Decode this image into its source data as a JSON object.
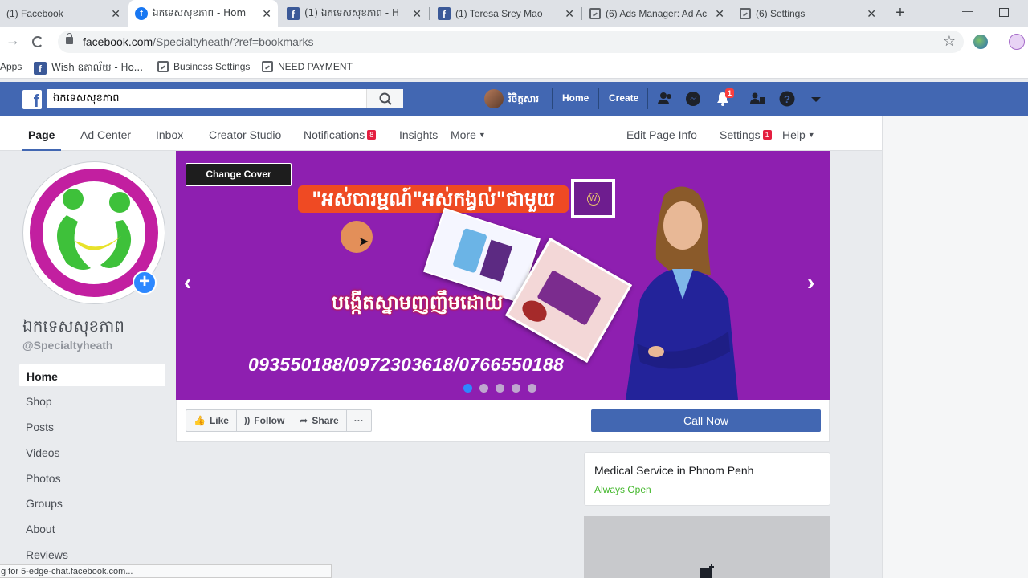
{
  "browser": {
    "tabs": [
      {
        "title": "(1) Facebook",
        "favicon": "facebook-icon"
      },
      {
        "title": "ឯកទេសសុខភាព - Hom",
        "favicon": "facebook-icon"
      },
      {
        "title": "(1) ឯកទេសសុខភាព - H",
        "favicon": "facebook-icon"
      },
      {
        "title": "(1) Teresa Srey Mao",
        "favicon": "facebook-icon"
      },
      {
        "title": "(6) Ads Manager: Ad Ac",
        "favicon": "document-icon"
      },
      {
        "title": "(6) Settings",
        "favicon": "document-icon"
      }
    ],
    "url_host": "facebook.com",
    "url_path": "/Specialtyheath/?ref=bookmarks",
    "bookmarks": [
      {
        "label": "Apps"
      },
      {
        "label": "Wish ឧតាល័យ - Ho..."
      },
      {
        "label": "Business Settings"
      },
      {
        "label": "NEED PAYMENT"
      }
    ],
    "status_text": "g for 5-edge-chat.facebook.com..."
  },
  "fb_header": {
    "search_value": "ឯកទេសសុខភាព",
    "profile_name": "រិថិត្តសារ",
    "home_label": "Home",
    "create_label": "Create",
    "notification_count": "1",
    "brand_color": "#4267b2"
  },
  "page_nav": {
    "tabs": [
      {
        "label": "Page",
        "badge": ""
      },
      {
        "label": "Ad Center",
        "badge": ""
      },
      {
        "label": "Inbox",
        "badge": ""
      },
      {
        "label": "Creator Studio",
        "badge": ""
      },
      {
        "label": "Notifications",
        "badge": "8"
      },
      {
        "label": "Insights",
        "badge": ""
      },
      {
        "label": "More",
        "badge": ""
      }
    ],
    "right": [
      {
        "label": "Edit Page Info",
        "badge": ""
      },
      {
        "label": "Settings",
        "badge": "1"
      },
      {
        "label": "Help",
        "badge": ""
      }
    ]
  },
  "page": {
    "name": "ឯកទេសសុខភាព",
    "handle": "@Specialtyheath",
    "left_nav": [
      "Home",
      "Shop",
      "Posts",
      "Videos",
      "Photos",
      "Groups",
      "About",
      "Reviews"
    ]
  },
  "cover": {
    "change_cover_label": "Change Cover",
    "headline": "\"អស់បារម្មណ៍\"អស់កង្វល់\"ជាមួយ",
    "subline": "បង្កើតស្នាមញញឹមដោយ",
    "phones": "093550188/0972303618/0766550188",
    "slide_count": 5,
    "active_slide": 1,
    "bg_color": "#8e1fb0"
  },
  "actions": {
    "like_label": "Like",
    "follow_label": "Follow",
    "share_label": "Share",
    "more_label": "···",
    "cta_label": "Call Now"
  },
  "info_card": {
    "category": "Medical Service in Phnom Penh",
    "hours": "Always Open",
    "hours_color": "#42b72a"
  }
}
